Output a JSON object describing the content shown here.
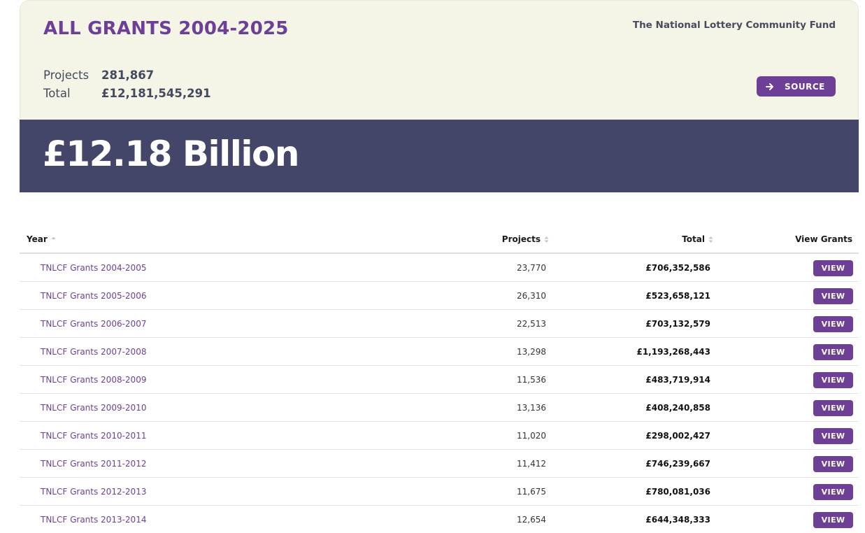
{
  "header": {
    "title": "ALL GRANTS 2004-2025",
    "org": "The National Lottery Community Fund",
    "stats": [
      {
        "label": "Projects",
        "value": "281,867"
      },
      {
        "label": "Total",
        "value": "£12,181,545,291"
      }
    ],
    "source_label": "SOURCE",
    "source_icon": "arrow-right-icon"
  },
  "banner": {
    "amount": "£12.18 Billion"
  },
  "colors": {
    "accent": "#6e3f96",
    "banner": "#434569",
    "card": "#f4f5e6"
  },
  "table": {
    "columns": {
      "year": "Year",
      "projects": "Projects",
      "total": "Total",
      "view": "View Grants"
    },
    "view_label": "VIEW",
    "rows": [
      {
        "year": "TNLCF Grants 2004-2005",
        "projects": "23,770",
        "total": "£706,352,586"
      },
      {
        "year": "TNLCF Grants 2005-2006",
        "projects": "26,310",
        "total": "£523,658,121"
      },
      {
        "year": "TNLCF Grants 2006-2007",
        "projects": "22,513",
        "total": "£703,132,579"
      },
      {
        "year": "TNLCF Grants 2007-2008",
        "projects": "13,298",
        "total": "£1,193,268,443"
      },
      {
        "year": "TNLCF Grants 2008-2009",
        "projects": "11,536",
        "total": "£483,719,914"
      },
      {
        "year": "TNLCF Grants 2009-2010",
        "projects": "13,136",
        "total": "£408,240,858"
      },
      {
        "year": "TNLCF Grants 2010-2011",
        "projects": "11,020",
        "total": "£298,002,427"
      },
      {
        "year": "TNLCF Grants 2011-2012",
        "projects": "11,412",
        "total": "£746,239,667"
      },
      {
        "year": "TNLCF Grants 2012-2013",
        "projects": "11,675",
        "total": "£780,081,036"
      },
      {
        "year": "TNLCF Grants 2013-2014",
        "projects": "12,654",
        "total": "£644,348,333"
      }
    ]
  }
}
